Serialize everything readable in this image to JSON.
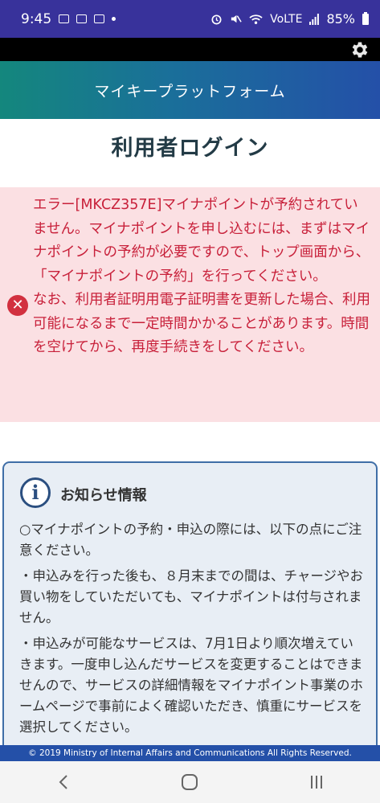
{
  "status_bar": {
    "time": "9:45",
    "battery": "85%",
    "network": "VoLTE"
  },
  "app": {
    "title": "マイキープラットフォーム"
  },
  "page": {
    "title": "利用者ログイン"
  },
  "error": {
    "paragraphs": [
      "エラー[MKCZ357E]マイナポイントが予約されていません。マイナポイントを申し込むには、まずはマイナポイントの予約が必要ですので、トップ画面から、「マイナポイントの予約」を行ってください。",
      "なお、利用者証明用電子証明書を更新した場合、利用可能になるまで一定時間かかることがあります。時間を空けてから、再度手続きをしてください。"
    ]
  },
  "notice": {
    "title": "お知らせ情報",
    "paragraphs": [
      "○マイナポイントの予約・申込の際には、以下の点にご注意ください。",
      "・申込みを行った後も、８月末までの間は、チャージやお買い物をしていただいても、マイナポイントは付与されません。",
      "・申込みが可能なサービスは、7月1日より順次増えていきます。一度申し込んだサービスを変更することはできませんので、サービスの詳細情報をマイナポイント事業のホームページで事前によく確認いただき、慎重にサービスを選択してください。"
    ]
  },
  "footer": {
    "copyright": "© 2019 Ministry of Internal Affairs and Communications All Rights Reserved."
  },
  "icons": {
    "settings": "gear-icon",
    "error": "error-x-icon",
    "info": "info-icon",
    "nav_back": "back-icon",
    "nav_home": "home-icon",
    "nav_recents": "recents-icon"
  },
  "colors": {
    "status_bar": "#38329b",
    "header_start": "#14877d",
    "header_end": "#2450a8",
    "error_bg": "#fbe0e3",
    "error_text": "#c8203a",
    "notice_bg": "#e8eef5",
    "notice_border": "#3f6ea7"
  }
}
